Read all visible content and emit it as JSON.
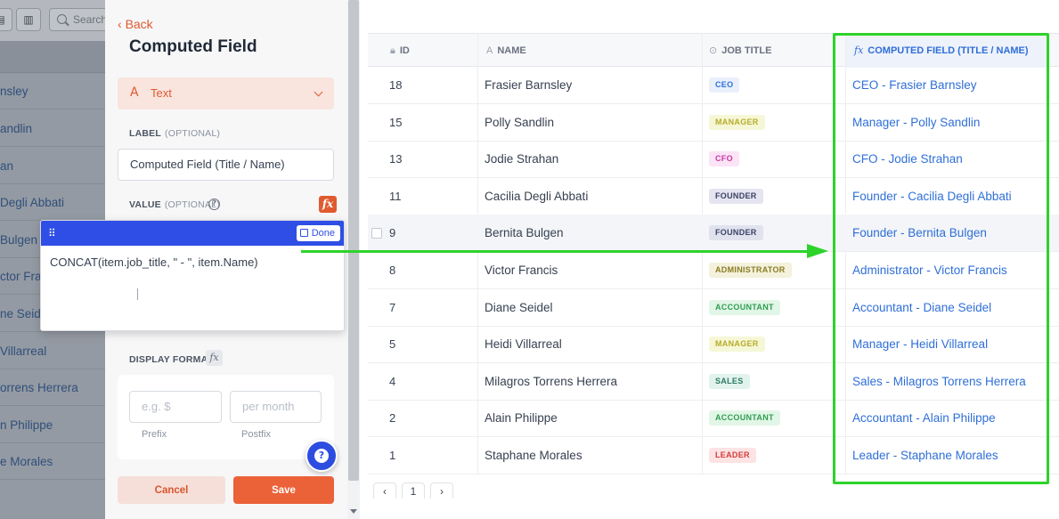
{
  "background_app": {
    "search_placeholder": "Search",
    "rows": [
      "nsley",
      "andlin",
      "an",
      "Degli Abbati",
      "Bulgen",
      "ctor Francis",
      "ne Seidel",
      "Villarreal",
      "orrens Herrera",
      "n Philippe",
      "e Morales"
    ],
    "icons": [
      "layout-icon",
      "columns-icon",
      "search-icon"
    ]
  },
  "drawer": {
    "back_label": "Back",
    "title": "Computed Field",
    "type_icon": "A",
    "type_label": "Text",
    "label_field": {
      "label": "LABEL",
      "optional": "(OPTIONAL)",
      "value": "Computed Field (Title / Name)"
    },
    "value_field": {
      "label": "VALUE",
      "optional": "(OPTIONAL)",
      "fx": "fx"
    },
    "display_format": {
      "label": "DISPLAY FORMAT",
      "fx": "fx",
      "prefix_placeholder": "e.g. $",
      "postfix_placeholder": "per month",
      "prefix_caption": "Prefix",
      "postfix_caption": "Postfix"
    },
    "help": "?",
    "cancel_label": "Cancel",
    "save_label": "Save"
  },
  "editor": {
    "done_label": "Done",
    "formula": "CONCAT(item.job_title, \" - \", item.Name)"
  },
  "table": {
    "headers": {
      "id": "ID",
      "name": "NAME",
      "job_title": "JOB TITLE",
      "computed": "COMPUTED FIELD (TITLE / NAME)",
      "computed_icon": "fx",
      "name_icon": "A"
    },
    "rows": [
      {
        "id": "18",
        "name": "Frasier Barnsley",
        "job": "CEO",
        "computed": "CEO - Frasier Barnsley",
        "badge_bg": "#eaf0fb",
        "badge_fg": "#2f6fd8"
      },
      {
        "id": "15",
        "name": "Polly Sandlin",
        "job": "MANAGER",
        "computed": "Manager - Polly Sandlin",
        "badge_bg": "#f6f7d7",
        "badge_fg": "#b7ad2a"
      },
      {
        "id": "13",
        "name": "Jodie Strahan",
        "job": "CFO",
        "computed": "CFO - Jodie Strahan",
        "badge_bg": "#fbe4f6",
        "badge_fg": "#c73aa6"
      },
      {
        "id": "11",
        "name": "Cacilia Degli Abbati",
        "job": "FOUNDER",
        "computed": "Founder - Cacilia Degli Abbati",
        "badge_bg": "#e4e5f0",
        "badge_fg": "#3c4266"
      },
      {
        "id": "9",
        "name": "Bernita Bulgen",
        "job": "FOUNDER",
        "computed": "Founder - Bernita Bulgen",
        "badge_bg": "#e0e2ee",
        "badge_fg": "#3c4266"
      },
      {
        "id": "8",
        "name": "Victor Francis",
        "job": "ADMINISTRATOR",
        "computed": "Administrator - Victor Francis",
        "badge_bg": "#f4f1dc",
        "badge_fg": "#8a7c24"
      },
      {
        "id": "7",
        "name": "Diane Seidel",
        "job": "ACCOUNTANT",
        "computed": "Accountant - Diane Seidel",
        "badge_bg": "#e2f6e7",
        "badge_fg": "#2f9e52"
      },
      {
        "id": "5",
        "name": "Heidi Villarreal",
        "job": "MANAGER",
        "computed": "Manager - Heidi Villarreal",
        "badge_bg": "#f6f7d7",
        "badge_fg": "#b7ad2a"
      },
      {
        "id": "4",
        "name": "Milagros Torrens Herrera",
        "job": "SALES",
        "computed": "Sales - Milagros Torrens Herrera",
        "badge_bg": "#e2f3ee",
        "badge_fg": "#2b7a62"
      },
      {
        "id": "2",
        "name": "Alain Philippe",
        "job": "ACCOUNTANT",
        "computed": "Accountant - Alain Philippe",
        "badge_bg": "#e2f6e7",
        "badge_fg": "#2f9e52"
      },
      {
        "id": "1",
        "name": "Staphane Morales",
        "job": "LEADER",
        "computed": "Leader - Staphane Morales",
        "badge_bg": "#fde3e3",
        "badge_fg": "#d33c3c"
      }
    ],
    "pagination": {
      "current_page": "1"
    }
  },
  "colors": {
    "accent": "#e05a30",
    "editor_bar": "#2e4ee6",
    "link": "#2f6fd8",
    "annotation": "#2dd32a"
  }
}
